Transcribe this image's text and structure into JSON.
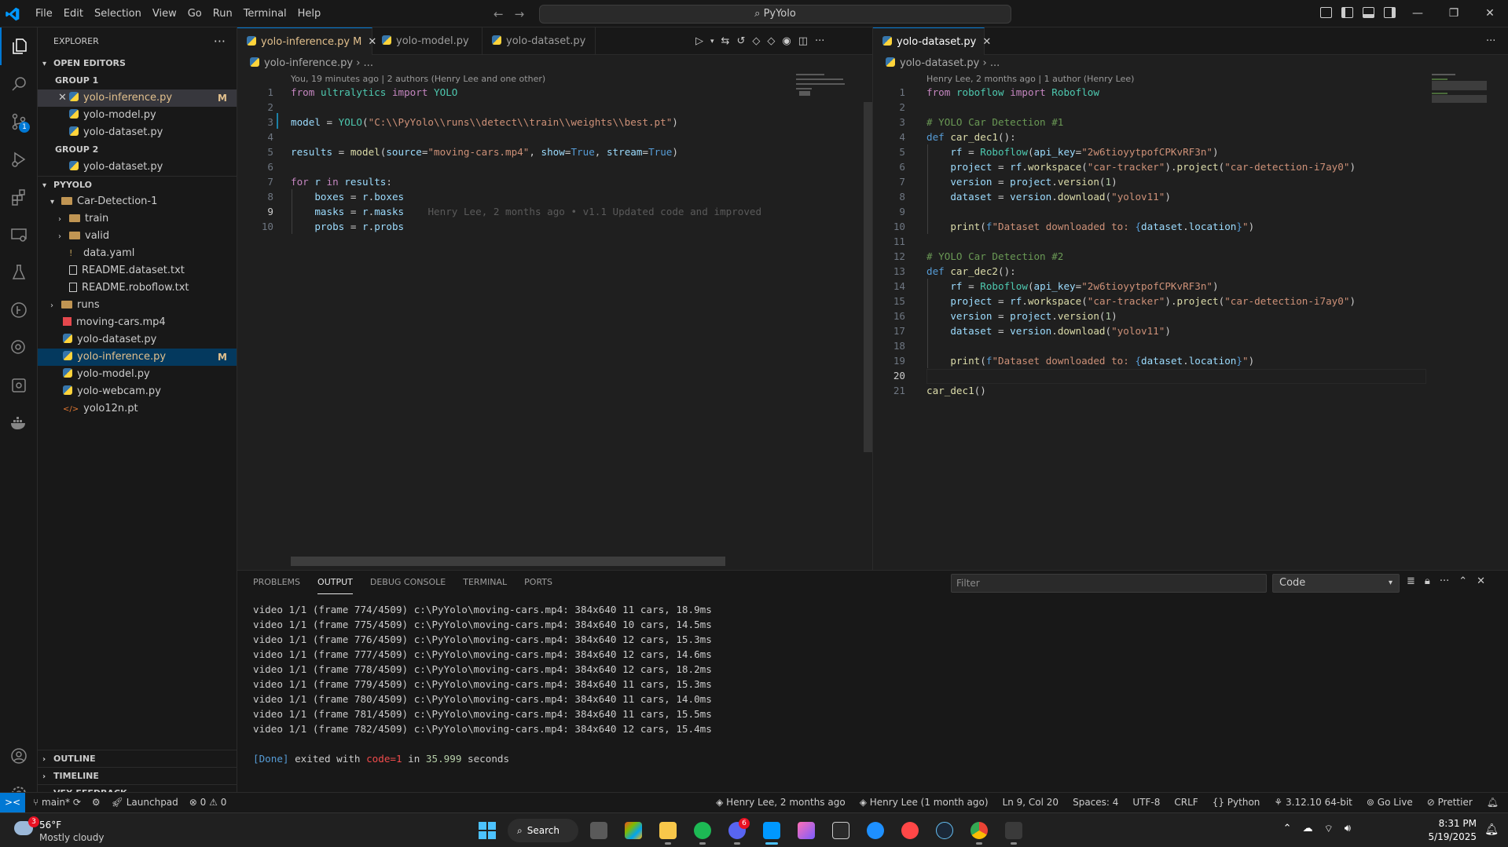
{
  "titlebar": {
    "menu": [
      "File",
      "Edit",
      "Selection",
      "View",
      "Go",
      "Run",
      "Terminal",
      "Help"
    ],
    "search": "PyYolo"
  },
  "activity": {
    "scm_badge": "1"
  },
  "sidebar": {
    "title": "EXPLORER",
    "open_editors": "OPEN EDITORS",
    "group1": "GROUP 1",
    "group2": "GROUP 2",
    "g1_files": [
      "yolo-inference.py",
      "yolo-model.py",
      "yolo-dataset.py"
    ],
    "g2_files": [
      "yolo-dataset.py"
    ],
    "modified": "M",
    "project": "PYYOLO",
    "tree": {
      "car_detection": "Car-Detection-1",
      "train": "train",
      "valid": "valid",
      "data_yaml": "data.yaml",
      "readme_dataset": "README.dataset.txt",
      "readme_roboflow": "README.roboflow.txt",
      "runs": "runs",
      "moving_cars": "moving-cars.mp4",
      "yolo_dataset": "yolo-dataset.py",
      "yolo_inference": "yolo-inference.py",
      "yolo_model": "yolo-model.py",
      "yolo_webcam": "yolo-webcam.py",
      "yolo12n": "yolo12n.pt"
    },
    "outline": "OUTLINE",
    "timeline": "TIMELINE",
    "vex": "VEX FEEDBACK"
  },
  "editor1": {
    "tabs": [
      {
        "label": "yolo-inference.py",
        "mod": "M"
      },
      {
        "label": "yolo-model.py"
      },
      {
        "label": "yolo-dataset.py"
      }
    ],
    "breadcrumb": "yolo-inference.py  ›  ...",
    "blame_header": "You, 19 minutes ago | 2 authors (Henry Lee and one other)",
    "ghost": "Henry Lee, 2 months ago • v1.1 Updated code and improved",
    "line_numbers": [
      "1",
      "2",
      "3",
      "4",
      "5",
      "6",
      "7",
      "8",
      "9",
      "10"
    ]
  },
  "editor2": {
    "tabs": [
      {
        "label": "yolo-dataset.py"
      }
    ],
    "breadcrumb": "yolo-dataset.py  ›  ...",
    "blame_header": "Henry Lee, 2 months ago | 1 author (Henry Lee)",
    "line_numbers": [
      "1",
      "2",
      "3",
      "4",
      "5",
      "6",
      "7",
      "8",
      "9",
      "10",
      "11",
      "12",
      "13",
      "14",
      "15",
      "16",
      "17",
      "18",
      "19",
      "20",
      "21"
    ]
  },
  "panel": {
    "tabs": [
      "PROBLEMS",
      "OUTPUT",
      "DEBUG CONSOLE",
      "TERMINAL",
      "PORTS"
    ],
    "filter_placeholder": "Filter",
    "channel": "Code",
    "lines": [
      "video 1/1 (frame 774/4509) c:\\PyYolo\\moving-cars.mp4: 384x640 11 cars, 18.9ms",
      "video 1/1 (frame 775/4509) c:\\PyYolo\\moving-cars.mp4: 384x640 10 cars, 14.5ms",
      "video 1/1 (frame 776/4509) c:\\PyYolo\\moving-cars.mp4: 384x640 12 cars, 15.3ms",
      "video 1/1 (frame 777/4509) c:\\PyYolo\\moving-cars.mp4: 384x640 12 cars, 14.6ms",
      "video 1/1 (frame 778/4509) c:\\PyYolo\\moving-cars.mp4: 384x640 12 cars, 18.2ms",
      "video 1/1 (frame 779/4509) c:\\PyYolo\\moving-cars.mp4: 384x640 11 cars, 15.3ms",
      "video 1/1 (frame 780/4509) c:\\PyYolo\\moving-cars.mp4: 384x640 11 cars, 14.0ms",
      "video 1/1 (frame 781/4509) c:\\PyYolo\\moving-cars.mp4: 384x640 11 cars, 15.5ms",
      "video 1/1 (frame 782/4509) c:\\PyYolo\\moving-cars.mp4: 384x640 12 cars, 15.4ms"
    ],
    "done_tag": "[Done]",
    "done_a": " exited with ",
    "done_code": "code=1",
    "done_b": " in ",
    "done_secs": "35.999",
    "done_c": " seconds"
  },
  "status": {
    "branch": "main*",
    "launchpad": "Launchpad",
    "errors": "0",
    "warnings": "0",
    "blame1": "Henry Lee, 2 months ago",
    "blame2": "Henry Lee (1 month ago)",
    "position": "Ln 9, Col 20",
    "spaces": "Spaces: 4",
    "encoding": "UTF-8",
    "eol": "CRLF",
    "language": "Python",
    "interpreter": "3.12.10 64-bit",
    "golive": "Go Live",
    "prettier": "Prettier"
  },
  "taskbar": {
    "weather_temp": "56°F",
    "weather_desc": "Mostly cloudy",
    "weather_badge": "3",
    "search": "Search",
    "discord_badge": "6",
    "time": "8:31 PM",
    "date": "5/19/2025"
  },
  "colors": {
    "accent": "#0078d4",
    "modified": "#e2c08d"
  }
}
